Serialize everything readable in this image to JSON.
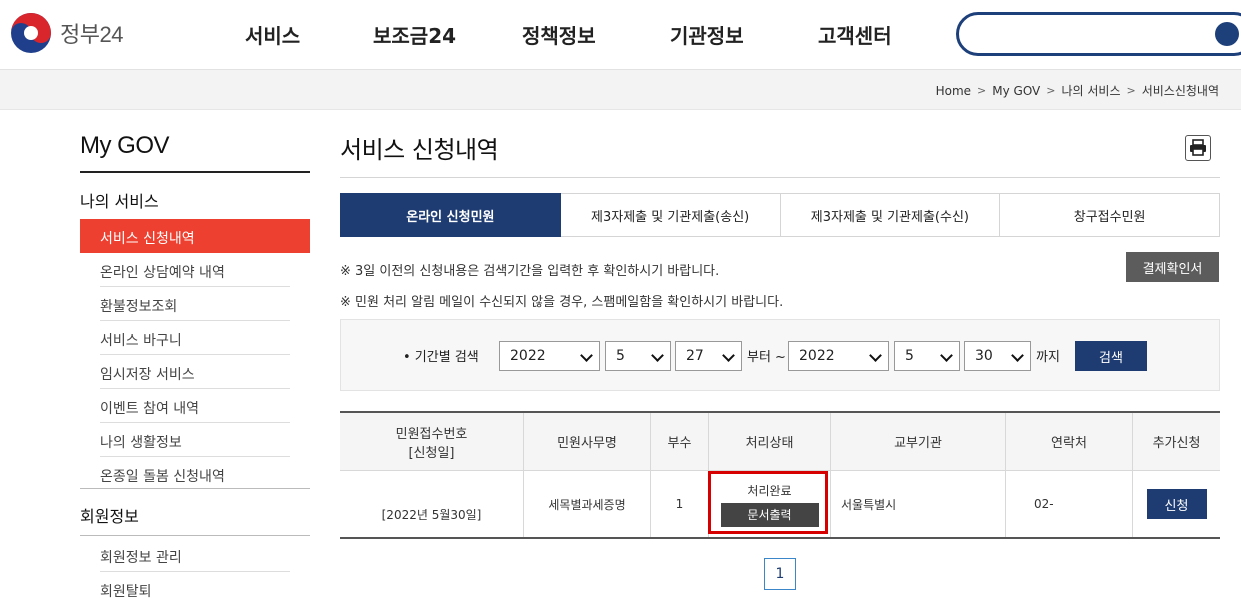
{
  "header": {
    "logo_text": "정부24",
    "nav": [
      "서비스",
      "보조금24",
      "정책정보",
      "기관정보",
      "고객센터"
    ],
    "search_placeholder": ""
  },
  "breadcrumb": [
    "Home",
    "My GOV",
    "나의 서비스",
    "서비스신청내역"
  ],
  "sidebar": {
    "title": "My GOV",
    "section1": "나의 서비스",
    "active_item": "서비스 신청내역",
    "items": [
      "온라인 상담예약 내역",
      "환불정보조회",
      "서비스 바구니",
      "임시저장 서비스",
      "이벤트 참여 내역",
      "나의 생활정보",
      "온종일 돌봄 신청내역"
    ],
    "section2": "회원정보",
    "member_items": [
      "회원정보 관리",
      "회원탈퇴"
    ]
  },
  "main": {
    "title": "서비스 신청내역",
    "tabs": [
      "온라인 신청민원",
      "제3자제출 및 기관제출(송신)",
      "제3자제출 및 기관제출(수신)",
      "창구접수민원"
    ],
    "notice1": "※ 3일 이전의 신청내용은 검색기간을 입력한 후 확인하시기 바랍니다.",
    "notice2": "※ 민원 처리 알림 메일이 수신되지 않을 경우, 스팸메일함을 확인하시기 바랍니다.",
    "receipt_button": "결제확인서",
    "search": {
      "label": "• 기간별 검색",
      "from_year": "2022",
      "from_month": "5",
      "from_day": "27",
      "from_text": "부터 ~",
      "to_year": "2022",
      "to_month": "5",
      "to_day": "30",
      "to_text": "까지",
      "button": "검색"
    },
    "table": {
      "headers": [
        "민원접수번호",
        "[신청일]",
        "민원사무명",
        "부수",
        "처리상태",
        "교부기관",
        "연락처",
        "추가신청"
      ],
      "row": {
        "date": "[2022년 5월30일]",
        "service": "세목별과세증명",
        "copies": "1",
        "status": "처리완료",
        "doc_button": "문서출력",
        "agency": "서울특별시",
        "contact": "02-",
        "apply_button": "신청"
      }
    },
    "page": "1"
  },
  "colors": {
    "primary": "#1e3c72",
    "active_side": "#ee4030",
    "highlight": "#d60000"
  }
}
